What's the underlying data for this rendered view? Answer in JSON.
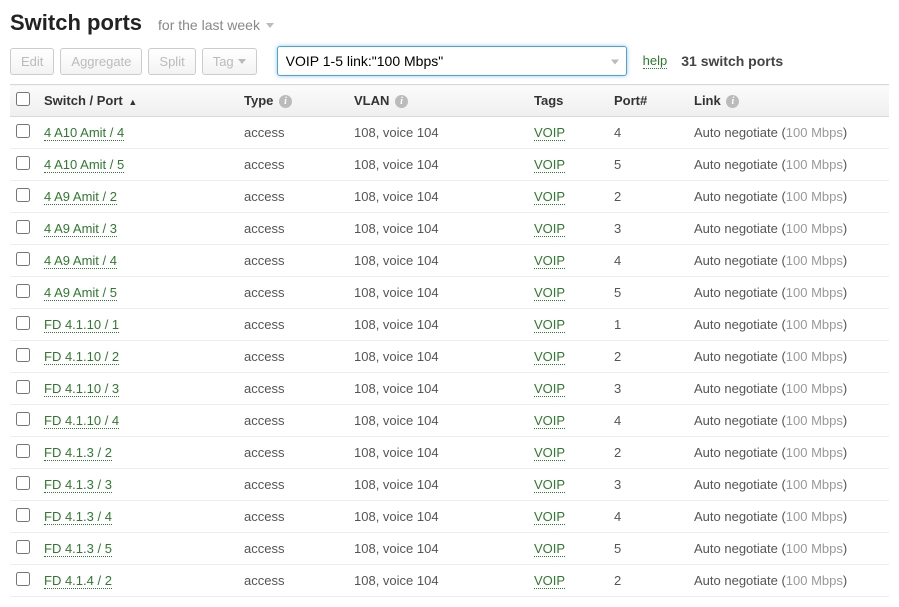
{
  "header": {
    "title": "Switch ports",
    "range_label": "for the last week"
  },
  "toolbar": {
    "edit_label": "Edit",
    "aggregate_label": "Aggregate",
    "split_label": "Split",
    "tag_label": "Tag",
    "search_value": "VOIP 1-5 link:\"100 Mbps\"",
    "help_label": "help",
    "count_label": "31 switch ports"
  },
  "columns": {
    "switch_port": "Switch / Port",
    "type": "Type",
    "vlan": "VLAN",
    "tags": "Tags",
    "port_num": "Port#",
    "link": "Link"
  },
  "rows": [
    {
      "switch_port": "4 A10 Amit / 4",
      "type": "access",
      "vlan": "108, voice 104",
      "tags": "VOIP",
      "port": "4",
      "link_prefix": "Auto negotiate (",
      "link_speed": "100 Mbps",
      "link_suffix": ")"
    },
    {
      "switch_port": "4 A10 Amit / 5",
      "type": "access",
      "vlan": "108, voice 104",
      "tags": "VOIP",
      "port": "5",
      "link_prefix": "Auto negotiate (",
      "link_speed": "100 Mbps",
      "link_suffix": ")"
    },
    {
      "switch_port": "4 A9 Amit / 2",
      "type": "access",
      "vlan": "108, voice 104",
      "tags": "VOIP",
      "port": "2",
      "link_prefix": "Auto negotiate (",
      "link_speed": "100 Mbps",
      "link_suffix": ")"
    },
    {
      "switch_port": "4 A9 Amit / 3",
      "type": "access",
      "vlan": "108, voice 104",
      "tags": "VOIP",
      "port": "3",
      "link_prefix": "Auto negotiate (",
      "link_speed": "100 Mbps",
      "link_suffix": ")"
    },
    {
      "switch_port": "4 A9 Amit / 4",
      "type": "access",
      "vlan": "108, voice 104",
      "tags": "VOIP",
      "port": "4",
      "link_prefix": "Auto negotiate (",
      "link_speed": "100 Mbps",
      "link_suffix": ")"
    },
    {
      "switch_port": "4 A9 Amit / 5",
      "type": "access",
      "vlan": "108, voice 104",
      "tags": "VOIP",
      "port": "5",
      "link_prefix": "Auto negotiate (",
      "link_speed": "100 Mbps",
      "link_suffix": ")"
    },
    {
      "switch_port": "FD 4.1.10 / 1",
      "type": "access",
      "vlan": "108, voice 104",
      "tags": "VOIP",
      "port": "1",
      "link_prefix": "Auto negotiate (",
      "link_speed": "100 Mbps",
      "link_suffix": ")"
    },
    {
      "switch_port": "FD 4.1.10 / 2",
      "type": "access",
      "vlan": "108, voice 104",
      "tags": "VOIP",
      "port": "2",
      "link_prefix": "Auto negotiate (",
      "link_speed": "100 Mbps",
      "link_suffix": ")"
    },
    {
      "switch_port": "FD 4.1.10 / 3",
      "type": "access",
      "vlan": "108, voice 104",
      "tags": "VOIP",
      "port": "3",
      "link_prefix": "Auto negotiate (",
      "link_speed": "100 Mbps",
      "link_suffix": ")"
    },
    {
      "switch_port": "FD 4.1.10 / 4",
      "type": "access",
      "vlan": "108, voice 104",
      "tags": "VOIP",
      "port": "4",
      "link_prefix": "Auto negotiate (",
      "link_speed": "100 Mbps",
      "link_suffix": ")"
    },
    {
      "switch_port": "FD 4.1.3 / 2",
      "type": "access",
      "vlan": "108, voice 104",
      "tags": "VOIP",
      "port": "2",
      "link_prefix": "Auto negotiate (",
      "link_speed": "100 Mbps",
      "link_suffix": ")"
    },
    {
      "switch_port": "FD 4.1.3 / 3",
      "type": "access",
      "vlan": "108, voice 104",
      "tags": "VOIP",
      "port": "3",
      "link_prefix": "Auto negotiate (",
      "link_speed": "100 Mbps",
      "link_suffix": ")"
    },
    {
      "switch_port": "FD 4.1.3 / 4",
      "type": "access",
      "vlan": "108, voice 104",
      "tags": "VOIP",
      "port": "4",
      "link_prefix": "Auto negotiate (",
      "link_speed": "100 Mbps",
      "link_suffix": ")"
    },
    {
      "switch_port": "FD 4.1.3 / 5",
      "type": "access",
      "vlan": "108, voice 104",
      "tags": "VOIP",
      "port": "5",
      "link_prefix": "Auto negotiate (",
      "link_speed": "100 Mbps",
      "link_suffix": ")"
    },
    {
      "switch_port": "FD 4.1.4 / 2",
      "type": "access",
      "vlan": "108, voice 104",
      "tags": "VOIP",
      "port": "2",
      "link_prefix": "Auto negotiate (",
      "link_speed": "100 Mbps",
      "link_suffix": ")"
    }
  ]
}
